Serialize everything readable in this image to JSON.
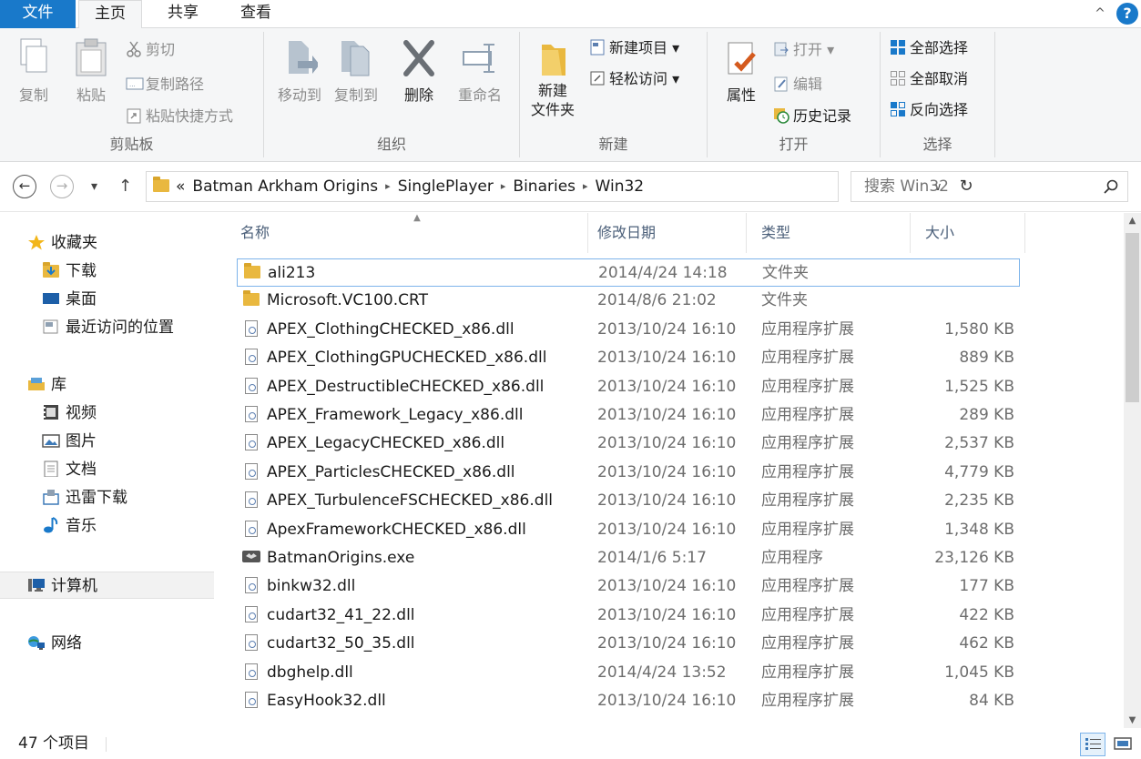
{
  "tabs": {
    "file": "文件",
    "home": "主页",
    "share": "共享",
    "view": "查看",
    "collapse_glyph": "^",
    "help_glyph": "?"
  },
  "ribbon": {
    "clipboard": {
      "label": "剪贴板",
      "copy": "复制",
      "paste": "粘贴",
      "cut": "剪切",
      "copy_path": "复制路径",
      "paste_shortcut": "粘贴快捷方式"
    },
    "organize": {
      "label": "组织",
      "move_to": "移动到",
      "copy_to": "复制到",
      "delete": "删除",
      "rename": "重命名"
    },
    "new": {
      "label": "新建",
      "new_folder_line1": "新建",
      "new_folder_line2": "文件夹",
      "new_item": "新建项目 ▾",
      "easy_access": "轻松访问 ▾"
    },
    "open": {
      "label": "打开",
      "properties": "属性",
      "open": "打开 ▾",
      "edit": "编辑",
      "history": "历史记录"
    },
    "select": {
      "label": "选择",
      "select_all": "全部选择",
      "select_none": "全部取消",
      "invert": "反向选择"
    }
  },
  "address": {
    "crumb_prefix": "«",
    "crumbs": [
      "Batman Arkham Origins",
      "SinglePlayer",
      "Binaries",
      "Win32"
    ],
    "separator": "▸",
    "search_placeholder": "搜索 Win32"
  },
  "nav": {
    "favorites": "收藏夹",
    "downloads": "下载",
    "desktop": "桌面",
    "recent": "最近访问的位置",
    "libraries": "库",
    "videos": "视频",
    "pictures": "图片",
    "documents": "文档",
    "thunder": "迅雷下载",
    "music": "音乐",
    "computer": "计算机",
    "network": "网络"
  },
  "columns": {
    "name": "名称",
    "date": "修改日期",
    "type": "类型",
    "size": "大小"
  },
  "files": [
    {
      "name": "ali213",
      "date": "2014/4/24 14:18",
      "type": "文件夹",
      "size": "",
      "kind": "folder"
    },
    {
      "name": "Microsoft.VC100.CRT",
      "date": "2014/8/6 21:02",
      "type": "文件夹",
      "size": "",
      "kind": "folder"
    },
    {
      "name": "APEX_ClothingCHECKED_x86.dll",
      "date": "2013/10/24 16:10",
      "type": "应用程序扩展",
      "size": "1,580 KB",
      "kind": "dll"
    },
    {
      "name": "APEX_ClothingGPUCHECKED_x86.dll",
      "date": "2013/10/24 16:10",
      "type": "应用程序扩展",
      "size": "889 KB",
      "kind": "dll"
    },
    {
      "name": "APEX_DestructibleCHECKED_x86.dll",
      "date": "2013/10/24 16:10",
      "type": "应用程序扩展",
      "size": "1,525 KB",
      "kind": "dll"
    },
    {
      "name": "APEX_Framework_Legacy_x86.dll",
      "date": "2013/10/24 16:10",
      "type": "应用程序扩展",
      "size": "289 KB",
      "kind": "dll"
    },
    {
      "name": "APEX_LegacyCHECKED_x86.dll",
      "date": "2013/10/24 16:10",
      "type": "应用程序扩展",
      "size": "2,537 KB",
      "kind": "dll"
    },
    {
      "name": "APEX_ParticlesCHECKED_x86.dll",
      "date": "2013/10/24 16:10",
      "type": "应用程序扩展",
      "size": "4,779 KB",
      "kind": "dll"
    },
    {
      "name": "APEX_TurbulenceFSCHECKED_x86.dll",
      "date": "2013/10/24 16:10",
      "type": "应用程序扩展",
      "size": "2,235 KB",
      "kind": "dll"
    },
    {
      "name": "ApexFrameworkCHECKED_x86.dll",
      "date": "2013/10/24 16:10",
      "type": "应用程序扩展",
      "size": "1,348 KB",
      "kind": "dll"
    },
    {
      "name": "BatmanOrigins.exe",
      "date": "2014/1/6 5:17",
      "type": "应用程序",
      "size": "23,126 KB",
      "kind": "exe"
    },
    {
      "name": "binkw32.dll",
      "date": "2013/10/24 16:10",
      "type": "应用程序扩展",
      "size": "177 KB",
      "kind": "dll"
    },
    {
      "name": "cudart32_41_22.dll",
      "date": "2013/10/24 16:10",
      "type": "应用程序扩展",
      "size": "422 KB",
      "kind": "dll"
    },
    {
      "name": "cudart32_50_35.dll",
      "date": "2013/10/24 16:10",
      "type": "应用程序扩展",
      "size": "462 KB",
      "kind": "dll"
    },
    {
      "name": "dbghelp.dll",
      "date": "2014/4/24 13:52",
      "type": "应用程序扩展",
      "size": "1,045 KB",
      "kind": "dll"
    },
    {
      "name": "EasyHook32.dll",
      "date": "2013/10/24 16:10",
      "type": "应用程序扩展",
      "size": "84 KB",
      "kind": "dll"
    }
  ],
  "status": {
    "count": "47 个项目"
  },
  "colors": {
    "accent": "#1979ca",
    "folder": "#e9b83f",
    "selection_border": "#7eb4ea"
  }
}
